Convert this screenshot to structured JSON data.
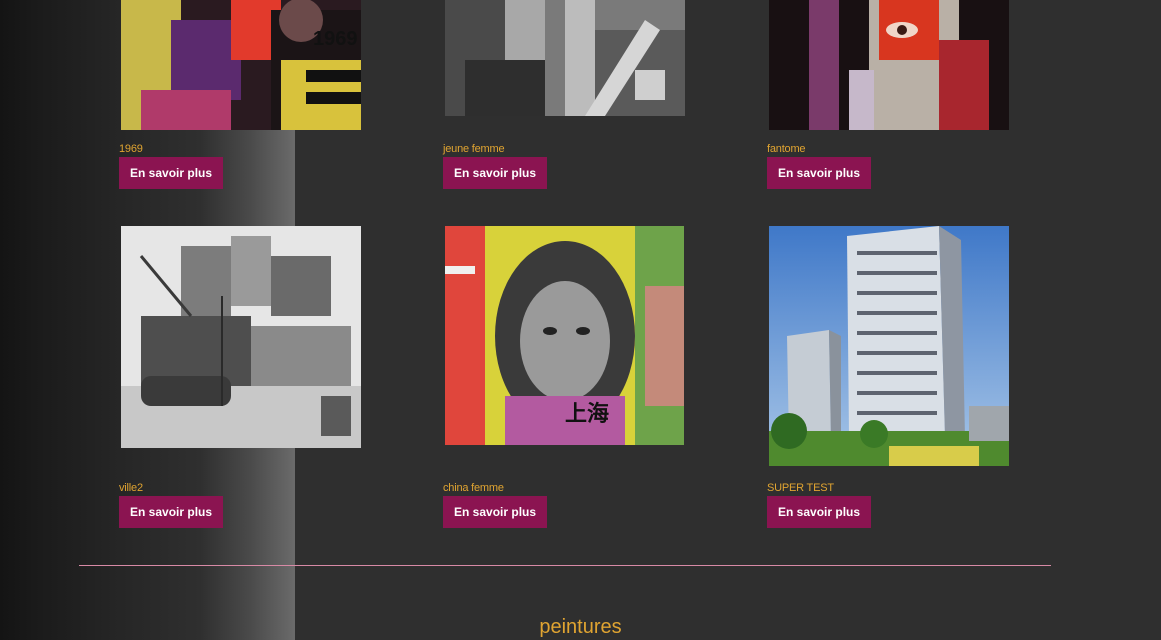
{
  "gallery": {
    "items": [
      {
        "caption": "1969",
        "button_label": "En savoir plus",
        "image_subject": "colorful collage with text and faces"
      },
      {
        "caption": "jeune femme",
        "button_label": "En savoir plus",
        "image_subject": "grayscale urban collage"
      },
      {
        "caption": "fantome",
        "button_label": "En savoir plus",
        "image_subject": "painted face with red eye"
      },
      {
        "caption": "ville2",
        "button_label": "En savoir plus",
        "image_subject": "black and white city street collage"
      },
      {
        "caption": "china femme",
        "button_label": "En savoir plus",
        "image_subject": "colorful portrait collage with chinese characters"
      },
      {
        "caption": "SUPER TEST",
        "button_label": "En savoir plus",
        "image_subject": "tall apartment tower under blue sky"
      }
    ]
  },
  "next_section": {
    "title": "peintures"
  },
  "colors": {
    "background": "#2f2f2f",
    "caption": "#e0a431",
    "button": "#8b1451",
    "divider": "#d88aa6"
  }
}
